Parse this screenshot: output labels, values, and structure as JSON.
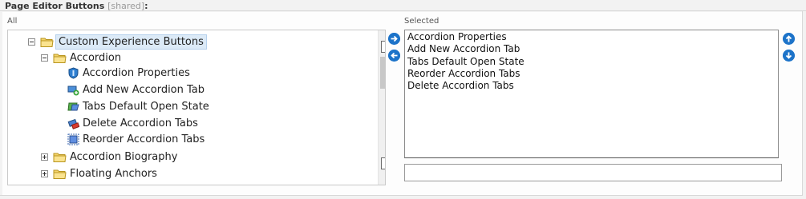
{
  "section": {
    "title": "Page Editor Buttons",
    "shared_tag": "[shared]",
    "colon": ":"
  },
  "all_panel": {
    "label": "All",
    "tree": [
      {
        "label": "Custom Experience Buttons",
        "expander": "minus",
        "icon": "folder-icon"
      },
      {
        "label": "Accordion",
        "expander": "minus",
        "icon": "folder-icon"
      },
      {
        "label": "Accordion Properties",
        "icon": "properties-shield-icon"
      },
      {
        "label": "Add New Accordion Tab",
        "icon": "add-tab-icon"
      },
      {
        "label": "Tabs Default Open State",
        "icon": "tabs-state-icon"
      },
      {
        "label": "Delete Accordion Tabs",
        "icon": "delete-tabs-icon"
      },
      {
        "label": "Reorder Accordion Tabs",
        "icon": "reorder-tabs-icon"
      },
      {
        "label": "Accordion Biography",
        "expander": "plus",
        "icon": "folder-icon"
      },
      {
        "label": "Floating Anchors",
        "expander": "plus",
        "icon": "folder-icon"
      }
    ]
  },
  "selected_panel": {
    "label": "Selected",
    "items": [
      "Accordion Properties",
      "Add New Accordion Tab",
      "Tabs Default Open State",
      "Reorder Accordion Tabs",
      "Delete Accordion Tabs"
    ],
    "input_value": ""
  },
  "controls": {
    "add_icon": "arrow-right-icon",
    "remove_icon": "arrow-left-icon",
    "move_up_icon": "arrow-up-icon",
    "move_down_icon": "arrow-down-icon",
    "accent_color": "#1c73c9"
  }
}
